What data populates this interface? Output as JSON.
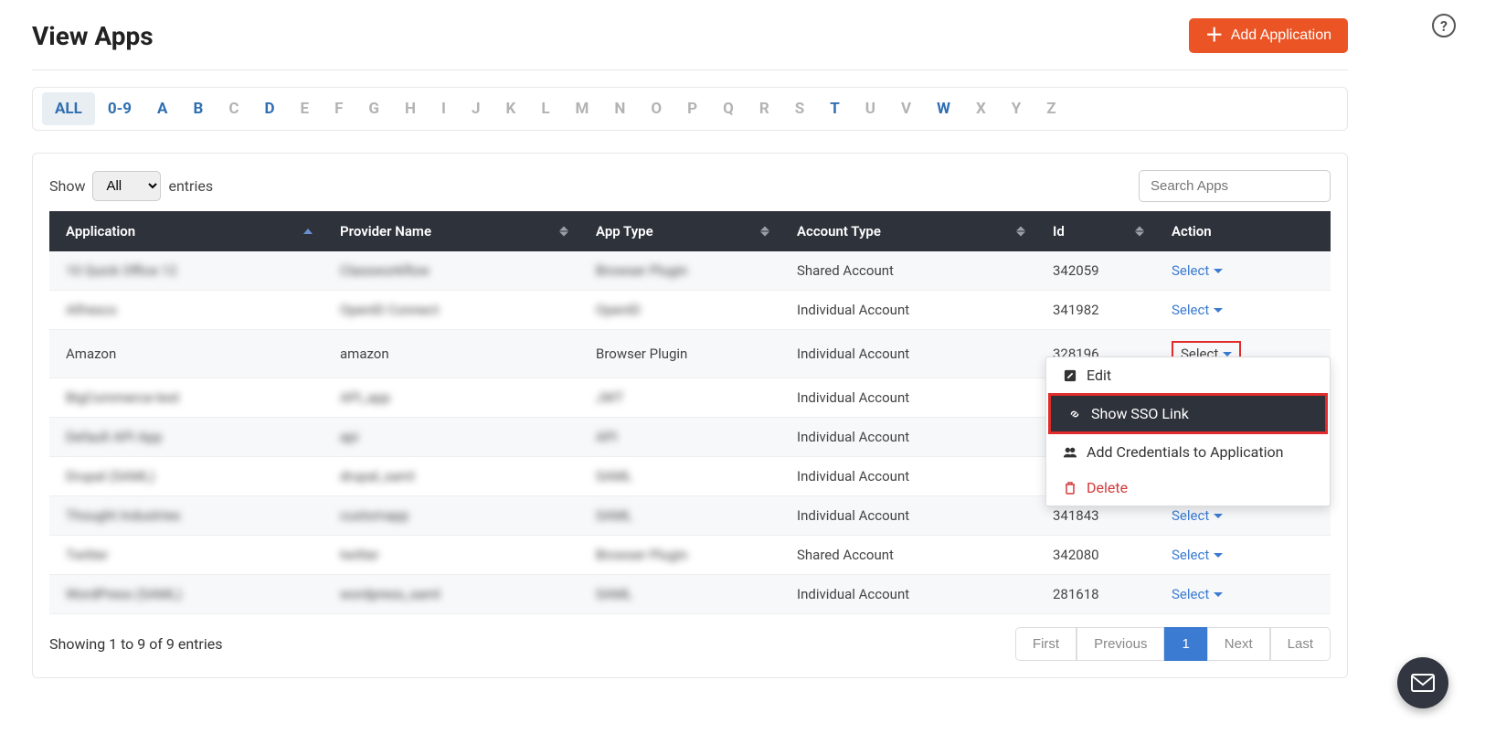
{
  "header": {
    "title": "View Apps",
    "add_button": "Add Application"
  },
  "alpha_filter": {
    "items": [
      "ALL",
      "0-9",
      "A",
      "B",
      "C",
      "D",
      "E",
      "F",
      "G",
      "H",
      "I",
      "J",
      "K",
      "L",
      "M",
      "N",
      "O",
      "P",
      "Q",
      "R",
      "S",
      "T",
      "U",
      "V",
      "W",
      "X",
      "Y",
      "Z"
    ],
    "active": "ALL",
    "blue_links": [
      "0-9",
      "A",
      "B",
      "D",
      "T",
      "W"
    ]
  },
  "show_entries": {
    "label_before": "Show",
    "selected": "All",
    "label_after": "entries"
  },
  "search": {
    "placeholder": "Search Apps"
  },
  "columns": {
    "application": "Application",
    "provider": "Provider Name",
    "app_type": "App Type",
    "account_type": "Account Type",
    "id": "Id",
    "action": "Action"
  },
  "action_label": "Select",
  "rows": [
    {
      "application": "10 Quick Office 12",
      "provider": "Classworkflow",
      "app_type": "Browser Plugin",
      "account_type": "Shared Account",
      "id": "342059",
      "blur": true,
      "highlight_select": false
    },
    {
      "application": "Alfresco",
      "provider": "OpenID Connect",
      "app_type": "OpenID",
      "account_type": "Individual Account",
      "id": "341982",
      "blur": true,
      "highlight_select": false
    },
    {
      "application": "Amazon",
      "provider": "amazon",
      "app_type": "Browser Plugin",
      "account_type": "Individual Account",
      "id": "328196",
      "blur": false,
      "highlight_select": true,
      "dropdown": true
    },
    {
      "application": "BigCommerce-test",
      "provider": "API_app",
      "app_type": "JWT",
      "account_type": "Individual Account",
      "id": " ",
      "blur": true,
      "highlight_select": false
    },
    {
      "application": "Default API App",
      "provider": "api",
      "app_type": "API",
      "account_type": "Individual Account",
      "id": " ",
      "blur": true,
      "highlight_select": false
    },
    {
      "application": "Drupal (SAML)",
      "provider": "drupal_saml",
      "app_type": "SAML",
      "account_type": "Individual Account",
      "id": " ",
      "blur": true,
      "highlight_select": false
    },
    {
      "application": "Thought Industries",
      "provider": "customapp",
      "app_type": "SAML",
      "account_type": "Individual Account",
      "id": "341843",
      "blur": true,
      "highlight_select": false
    },
    {
      "application": "Twitter",
      "provider": "twitter",
      "app_type": "Browser Plugin",
      "account_type": "Shared Account",
      "id": "342080",
      "blur": true,
      "highlight_select": false
    },
    {
      "application": "WordPress (SAML)",
      "provider": "wordpress_saml",
      "app_type": "SAML",
      "account_type": "Individual Account",
      "id": "281618",
      "blur": true,
      "highlight_select": false
    }
  ],
  "dropdown": {
    "edit": "Edit",
    "show_sso": "Show SSO Link",
    "add_creds": "Add Credentials to Application",
    "delete": "Delete"
  },
  "footer": {
    "summary": "Showing 1 to 9 of 9 entries",
    "first": "First",
    "previous": "Previous",
    "page1": "1",
    "next": "Next",
    "last": "Last"
  }
}
